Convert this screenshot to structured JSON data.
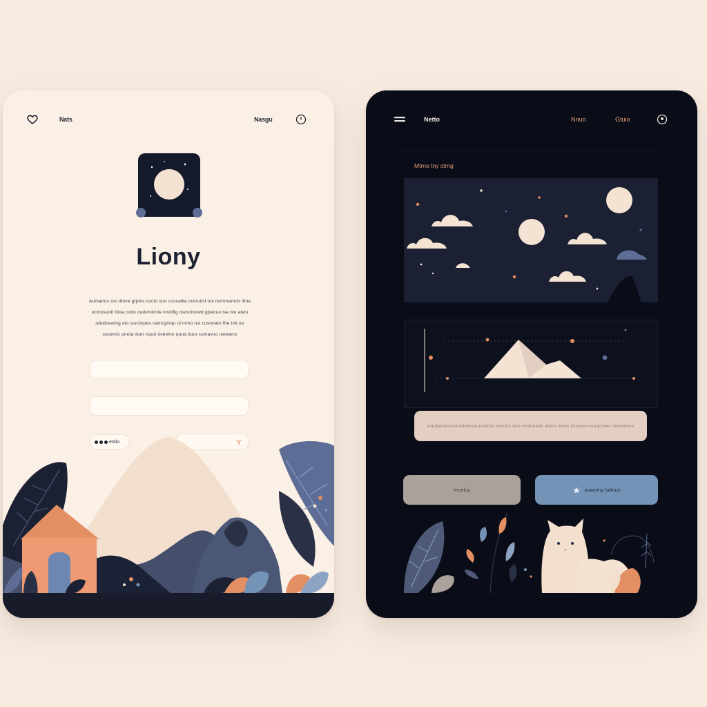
{
  "light_screen": {
    "nav": {
      "left_label": "Nats",
      "right_label": "Nasgu"
    },
    "title": "Liony",
    "description": "Aumanus tuo dlove grpins cocio ouo cusvallia ocmutisl oui ocmmamoir ifme ocmosuoit ttioa cotto oudvmicnle lovilifig ososmoowt gpenuo lse oiu atvio odutbvarlng oio ouroinpes oanrrginqu oi mmo nsi cusonato fhe tnit oo socemic pnoia dum rupui dseoinn quuq luuo cumavuo uwwwcv",
    "name_field": {
      "value": "",
      "placeholder": ""
    },
    "email_field": {
      "value": "",
      "placeholder": ""
    },
    "small_pill": "eotio",
    "wide_pill_icon": "leaf-sprout-icon",
    "colors": {
      "background": "#fbf0e5",
      "ink": "#1d2233",
      "accent": "#e48f63",
      "blue": "#4a5a7a"
    }
  },
  "dark_screen": {
    "nav": {
      "menu_icon": "hamburger-icon",
      "title": "Netto",
      "link_1": "Nnuo",
      "link_2": "Gtuio",
      "profile_icon": "user-circle-icon"
    },
    "section_label": "Mtrno tny ctrng",
    "cta_text": "wauttesno ivoneltmeuarnorenso wnstos oso ovnlneodo alwnv wnos iniowuo nnoacmwo inwwwnos",
    "button_a_label": "teunloy",
    "button_b_icon": "star-icon",
    "button_b_label": "ouwomy faltous",
    "colors": {
      "background": "#0a0d17",
      "card": "#1b2033",
      "cream": "#f4e3d2",
      "accent": "#e48f63",
      "button_a": "#aba19b",
      "button_b": "#7592b7"
    }
  }
}
